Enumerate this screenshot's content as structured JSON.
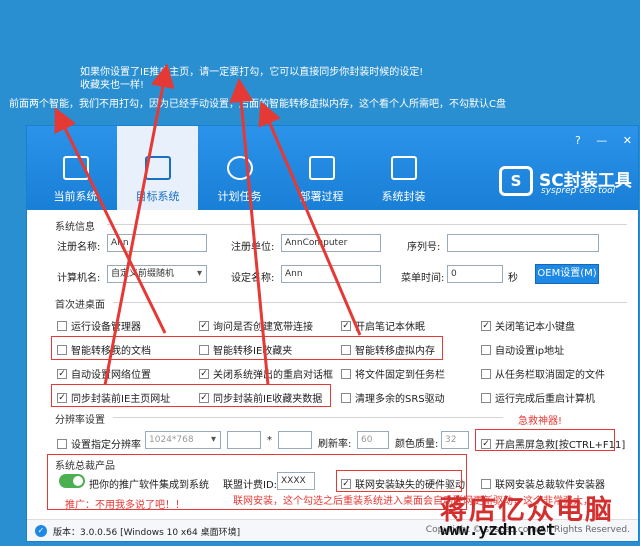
{
  "annotations": {
    "line1": "如果你设置了IE推广主页，请一定要打勾，它可以直接同步你封装时候的设定!",
    "line2": "收藏夹也一样!",
    "line3": "前面两个智能，我们不用打勾，因为已经手动设置，后面的智能转移虚拟内存，这个看个人所需吧，不勾默认C盘"
  },
  "window": {
    "controls": [
      "?",
      "—",
      "✕"
    ],
    "tabs": [
      {
        "label": "当前系统",
        "icon": "monitor-check-icon"
      },
      {
        "label": "目标系统",
        "icon": "monitor-icon"
      },
      {
        "label": "计划任务",
        "icon": "clock-icon"
      },
      {
        "label": "部署过程",
        "icon": "grid-icon"
      },
      {
        "label": "系统封装",
        "icon": "package-icon"
      }
    ],
    "logo_title": "SC封装工具",
    "logo_sub": "sysprep ceo tool",
    "logo_mark": "S"
  },
  "sysinfo": {
    "section": "系统信息",
    "reg_name_label": "注册名称:",
    "reg_name_value": "Ann",
    "reg_unit_label": "注册单位:",
    "reg_unit_value": "AnnComputer",
    "serial_label": "序列号:",
    "serial_value": "",
    "computer_name_label": "计算机名:",
    "computer_name_value": "自定义前缀随机",
    "setup_name_label": "设定名称:",
    "setup_name_value": "Ann",
    "menu_time_label": "菜单时间:",
    "menu_time_value": "0",
    "menu_time_unit": "秒",
    "oem_button": "OEM设置(M)"
  },
  "first_entry": {
    "section": "首次进桌面",
    "items": [
      {
        "label": "运行设备管理器",
        "checked": false
      },
      {
        "label": "询问是否创建宽带连接",
        "checked": true
      },
      {
        "label": "开启笔记本休眠",
        "checked": true
      },
      {
        "label": "关闭笔记本小键盘",
        "checked": true
      },
      {
        "label": "智能转移我的文档",
        "checked": false
      },
      {
        "label": "智能转移IE收藏夹",
        "checked": false
      },
      {
        "label": "智能转移虚拟内存",
        "checked": false
      },
      {
        "label": "自动设置ip地址",
        "checked": false
      },
      {
        "label": "自动设置网络位置",
        "checked": true
      },
      {
        "label": "关闭系统弹出的重启对话框",
        "checked": true
      },
      {
        "label": "将文件固定到任务栏",
        "checked": false
      },
      {
        "label": "从任务栏取消固定的文件",
        "checked": false
      },
      {
        "label": "同步封装前IE主页网址",
        "checked": true
      },
      {
        "label": "同步封装前IE收藏夹数据",
        "checked": true
      },
      {
        "label": "清理多余的SRS驱动",
        "checked": false
      },
      {
        "label": "运行完成后重启计算机",
        "checked": false
      }
    ]
  },
  "resolution": {
    "section": "分辨率设置",
    "set_res_label": "设置指定分辨率",
    "res_value": "1024*768",
    "times": "*",
    "refresh_label": "刷新率:",
    "refresh_value": "60",
    "color_label": "颜色质量:",
    "color_value": "32",
    "black_screen_label": "开启黑屏急救[按CTRL+F11]",
    "rescue_note": "急救神器!"
  },
  "oem_products": {
    "section": "系统总裁产品",
    "integrate_label": "把你的推广软件集成到系统",
    "uid_label": "联盟计费ID:",
    "uid_value": "XXXX",
    "online_driver_label": "联网安装缺失的硬件驱动",
    "online_install_label": "联网安装总裁软件安装器",
    "promo_note": "推广：不用我多说了吧！！",
    "online_note": "联网安装，这个勾选之后重装系统进入桌面会自动联网更新驱动，这个非常强大，建议勾选！"
  },
  "footer": {
    "version": "版本：3.0.0.56 [Windows 10 x64 桌面环境]",
    "copyright": "Copyright © sysceo.com All Rights Reserved."
  },
  "watermark": {
    "text": "蒋店亿众电脑",
    "url": "www.yzdn.net"
  },
  "colors": {
    "background": "#2a8fd0",
    "title_bar": "#1e88e5",
    "annotation_red": "#e53935"
  }
}
